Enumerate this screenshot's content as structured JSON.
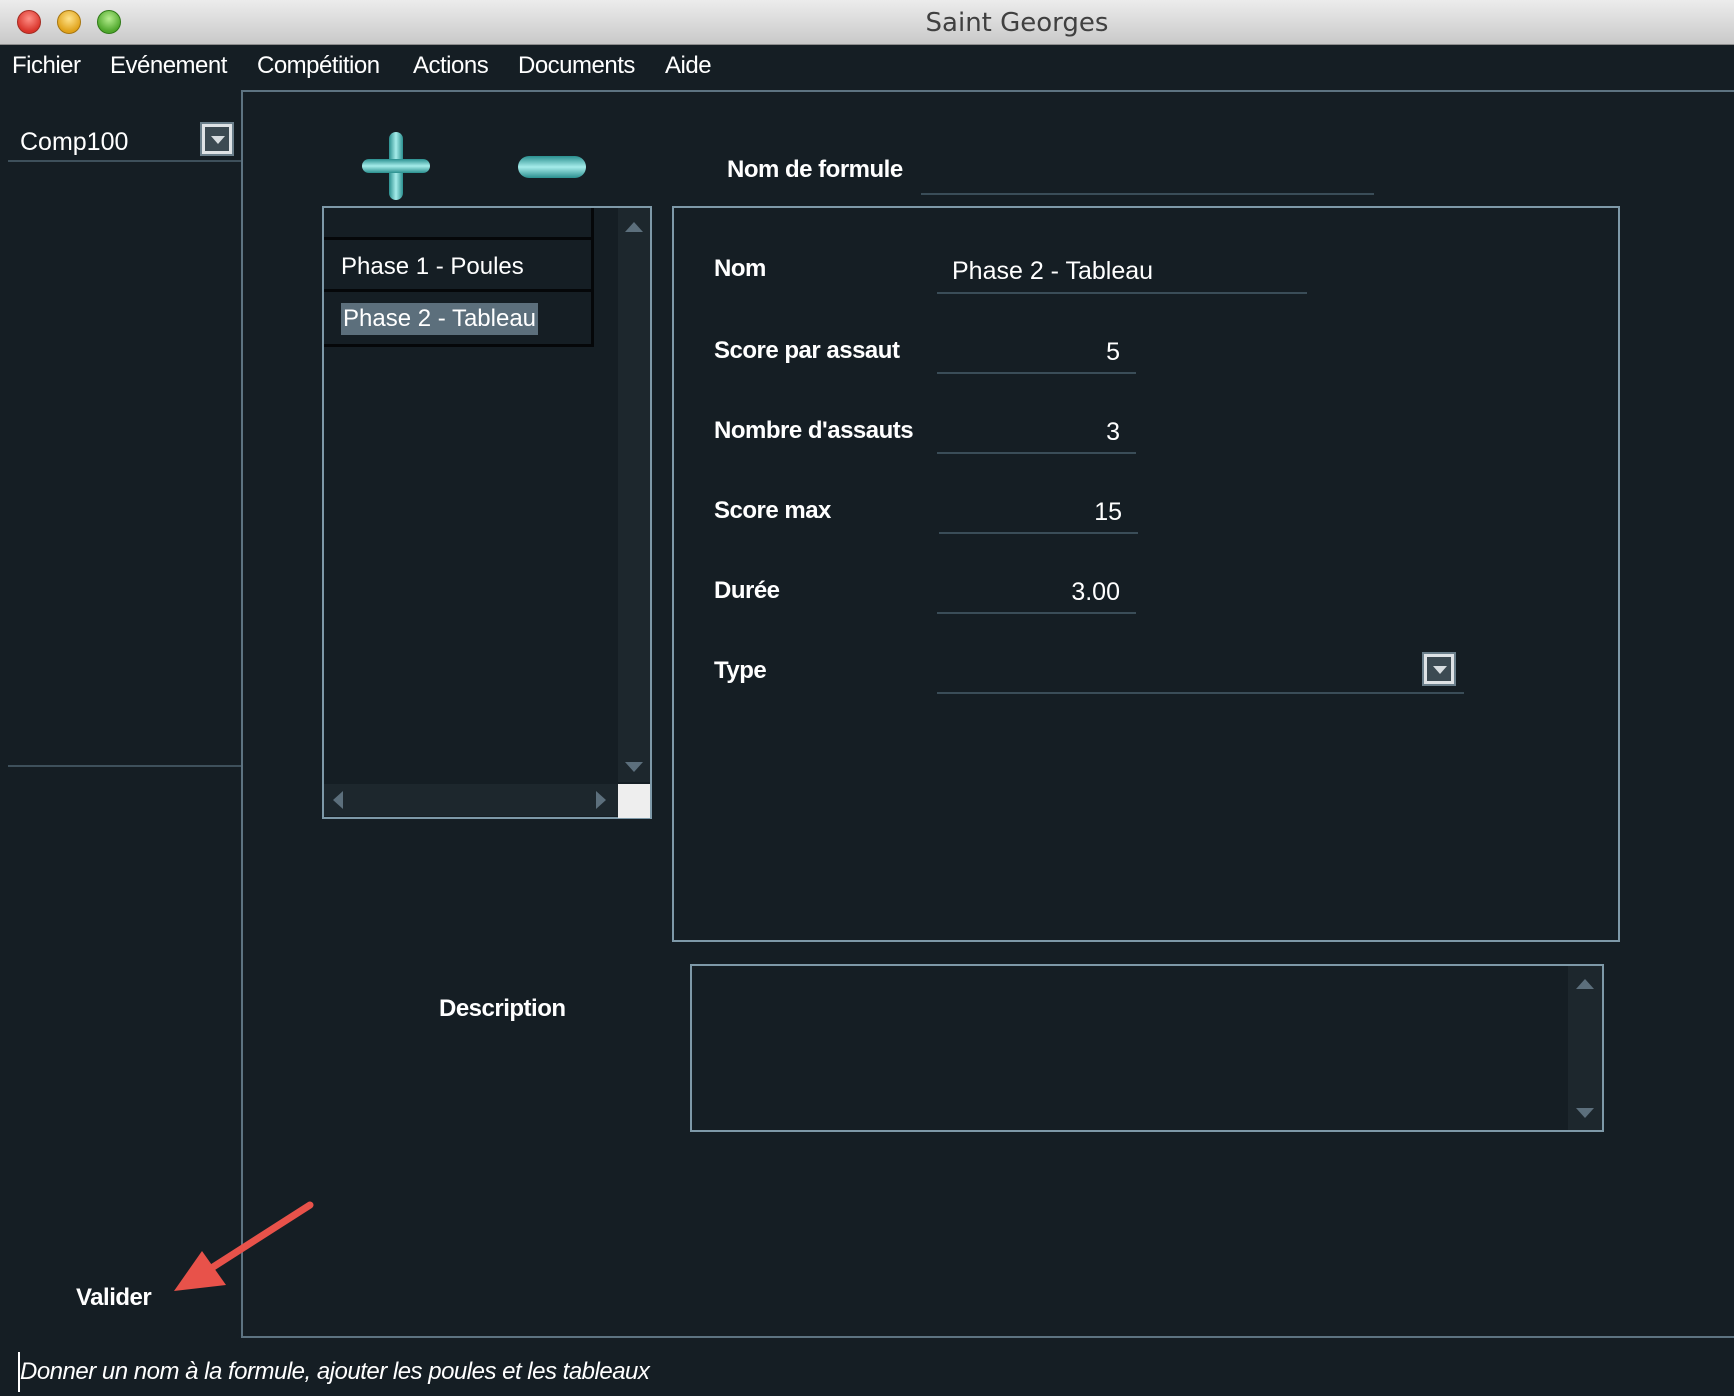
{
  "window": {
    "title": "Saint Georges"
  },
  "menu": {
    "items": [
      "Fichier",
      "Evénement",
      "Compétition",
      "Actions",
      "Documents",
      "Aide"
    ]
  },
  "competition_select": {
    "value": "Comp100"
  },
  "formula": {
    "name_label": "Nom de formule",
    "name_value": ""
  },
  "phases": [
    "Phase 1 - Poules",
    "Phase 2 - Tableau"
  ],
  "selected_phase_index": 1,
  "form": {
    "nom_label": "Nom",
    "nom_value": "Phase 2 - Tableau",
    "score_par_assaut_label": "Score par assaut",
    "score_par_assaut_value": "5",
    "nombre_assauts_label": "Nombre d'assauts",
    "nombre_assauts_value": "3",
    "score_max_label": "Score max",
    "score_max_value": "15",
    "duree_label": "Durée",
    "duree_value": "3.00",
    "type_label": "Type",
    "type_value": ""
  },
  "description": {
    "label": "Description",
    "value": ""
  },
  "validate_label": "Valider",
  "status": "Donner un nom à la formule, ajouter les poules et les tableaux",
  "colors": {
    "background": "#151e24",
    "border": "#7e99a8",
    "accent_teal": "#4fc3c0",
    "arrow_red": "#e8524a"
  }
}
